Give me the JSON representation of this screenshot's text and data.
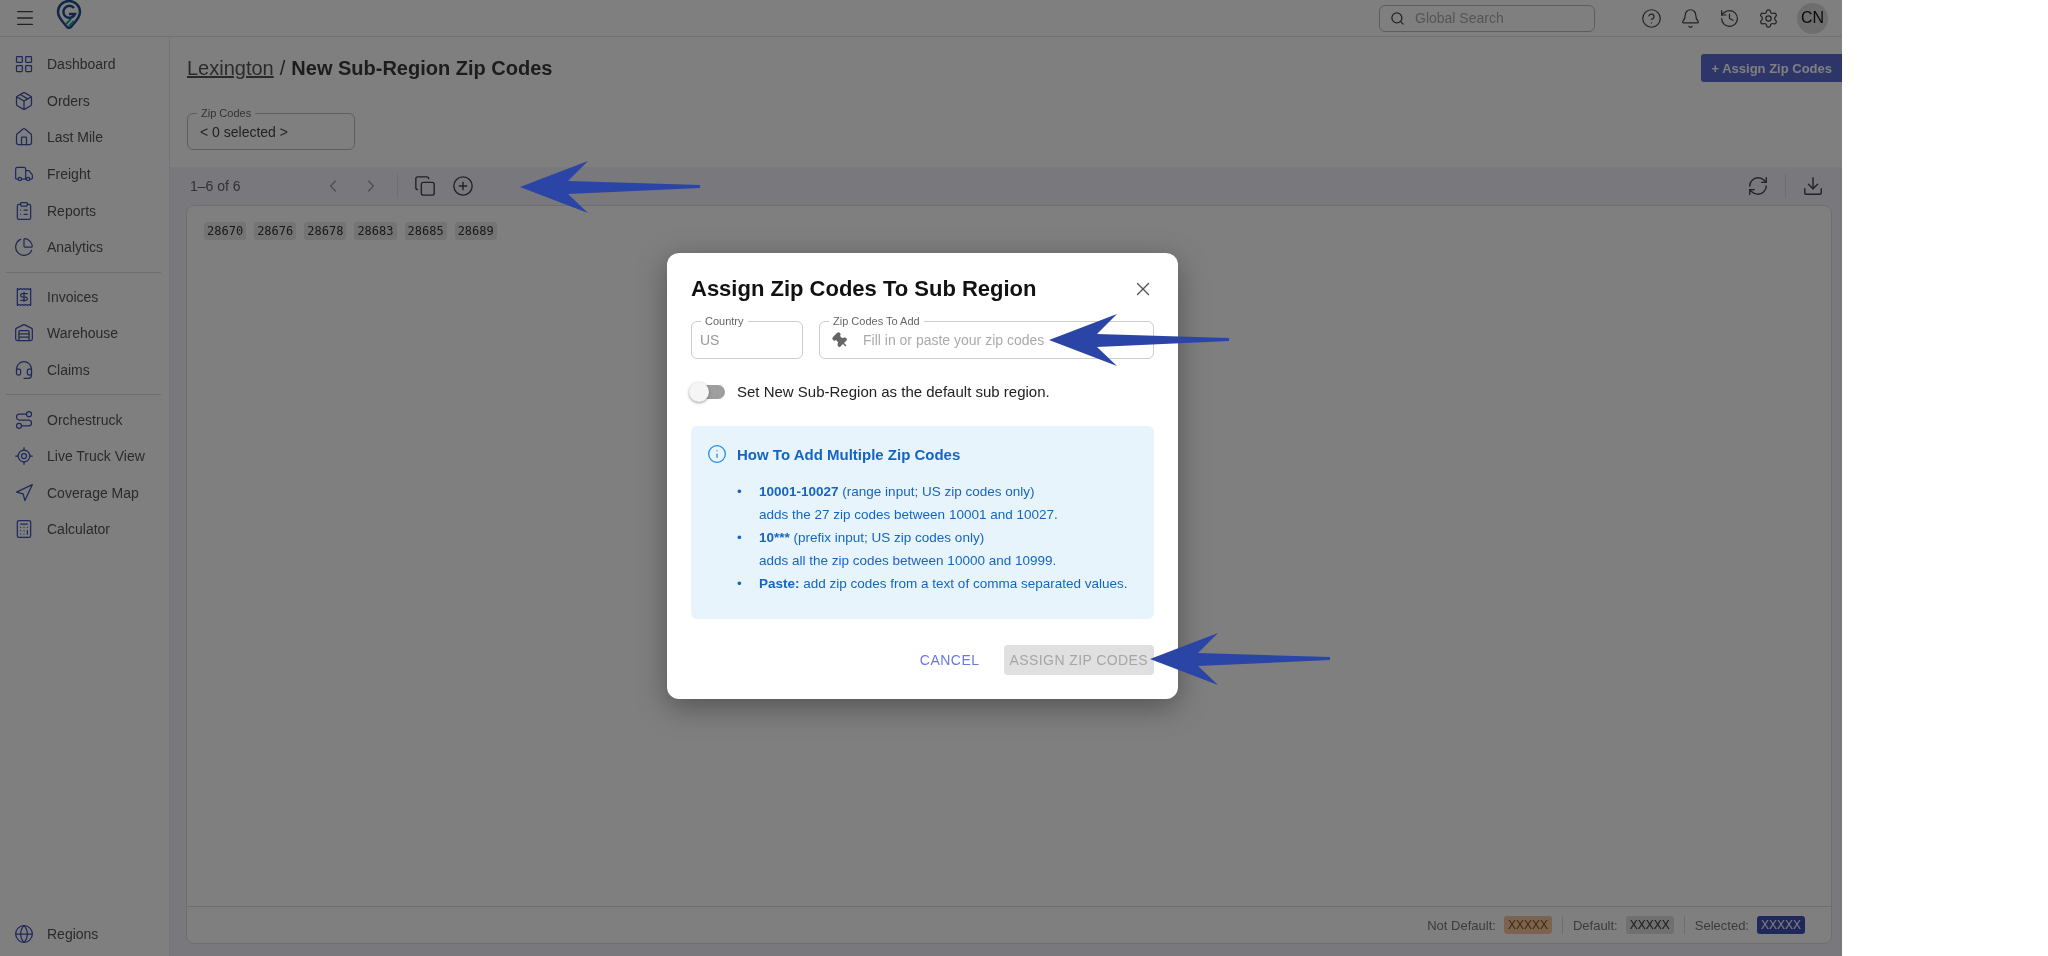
{
  "header": {
    "search": {
      "placeholder": "Global Search"
    },
    "avatar": "CN"
  },
  "sidebar": {
    "groups": [
      [
        {
          "label": "Dashboard"
        },
        {
          "label": "Orders"
        },
        {
          "label": "Last Mile"
        },
        {
          "label": "Freight"
        },
        {
          "label": "Reports"
        },
        {
          "label": "Analytics"
        }
      ],
      [
        {
          "label": "Invoices"
        },
        {
          "label": "Warehouse"
        },
        {
          "label": "Claims"
        }
      ],
      [
        {
          "label": "Orchestruck"
        },
        {
          "label": "Live Truck View"
        },
        {
          "label": "Coverage Map"
        },
        {
          "label": "Calculator"
        }
      ]
    ],
    "bottom_item": {
      "label": "Regions"
    }
  },
  "breadcrumb": {
    "parent": "Lexington",
    "separator": "/",
    "current": "New Sub-Region Zip Codes"
  },
  "assign_button": "+ Assign Zip Codes",
  "zip_filter": {
    "label": "Zip Codes",
    "value": "< 0 selected >"
  },
  "toolbar": {
    "range": "1–6 of 6"
  },
  "zip_codes": [
    {
      "code": "28670"
    },
    {
      "code": "28676"
    },
    {
      "code": "28678"
    },
    {
      "code": "28683"
    },
    {
      "code": "28685"
    },
    {
      "code": "28689"
    }
  ],
  "legend": [
    {
      "label": "Not Default:",
      "sample": "XXXXX",
      "color": "#7a6451"
    },
    {
      "label": "Default:",
      "sample": "XXXXX",
      "color": "#707070"
    },
    {
      "label": "Selected:",
      "sample": "XXXXX",
      "color": "#20285a"
    }
  ],
  "dialog": {
    "title": "Assign Zip Codes To Sub Region",
    "country": {
      "label": "Country",
      "value": "US"
    },
    "zip_input": {
      "label": "Zip Codes To Add",
      "placeholder": "Fill in or paste your zip codes"
    },
    "default_toggle": {
      "label": "Set New Sub-Region as the default sub region.",
      "on": false
    },
    "info": {
      "title": "How To Add Multiple Zip Codes",
      "bullets": [
        {
          "marker": "•",
          "term": "10001-10027",
          "text": "(range input; US zip codes only)",
          "detail": "adds the 27 zip codes between 10001 and 10027."
        },
        {
          "marker": "•",
          "term": "10***",
          "text": "(prefix input; US zip codes only)",
          "detail": "adds all the zip codes between 10000 and 10999."
        },
        {
          "marker": "•",
          "term": "Paste:",
          "text": "add zip codes from a text of comma separated values."
        }
      ]
    },
    "cancel": "CANCEL",
    "submit": {
      "label": "ASSIGN ZIP CODES",
      "disabled": true
    }
  }
}
